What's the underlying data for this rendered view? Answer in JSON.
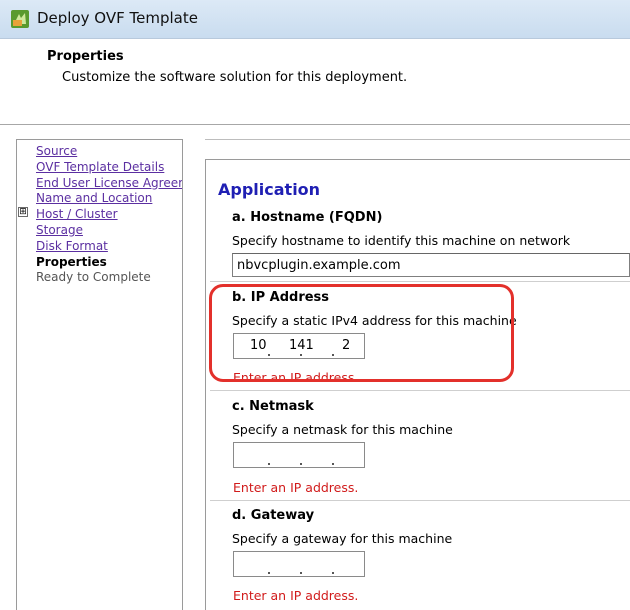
{
  "window": {
    "title": "Deploy OVF Template"
  },
  "header": {
    "title": "Properties",
    "subtitle": "Customize the software solution for this deployment."
  },
  "sidebar": {
    "items": [
      {
        "label": "Source",
        "state": "link"
      },
      {
        "label": "OVF Template Details",
        "state": "link"
      },
      {
        "label": "End User License Agreement",
        "state": "link"
      },
      {
        "label": "Name and Location",
        "state": "link"
      },
      {
        "label": "Host / Cluster",
        "state": "link"
      },
      {
        "label": "Storage",
        "state": "link"
      },
      {
        "label": "Disk Format",
        "state": "link"
      },
      {
        "label": "Properties",
        "state": "current"
      },
      {
        "label": "Ready to Complete",
        "state": "pending"
      }
    ],
    "expander_symbol": "⊞"
  },
  "main": {
    "heading": "Application",
    "hostname": {
      "label": "a. Hostname (FQDN)",
      "description": "Specify hostname to identify this machine on network",
      "value": "nbvcplugin.example.com"
    },
    "ip": {
      "label": "b. IP Address",
      "description": "Specify a static IPv4 address for this machine",
      "octets": [
        "10",
        "141",
        "2",
        ""
      ],
      "error": "Enter an IP address."
    },
    "netmask": {
      "label": "c. Netmask",
      "description": "Specify a netmask for this machine",
      "octets": [
        "",
        "",
        "",
        ""
      ],
      "error": "Enter an IP address."
    },
    "gateway": {
      "label": "d. Gateway",
      "description": "Specify a gateway for this machine",
      "octets": [
        "",
        "",
        "",
        ""
      ],
      "error": "Enter an IP address."
    }
  },
  "colors": {
    "heading": "#1f1fb3",
    "error": "#d11b1b",
    "link": "#5b2fa1",
    "highlight": "#e3302b"
  },
  "icons": {
    "app": "vsphere-deploy-icon"
  }
}
